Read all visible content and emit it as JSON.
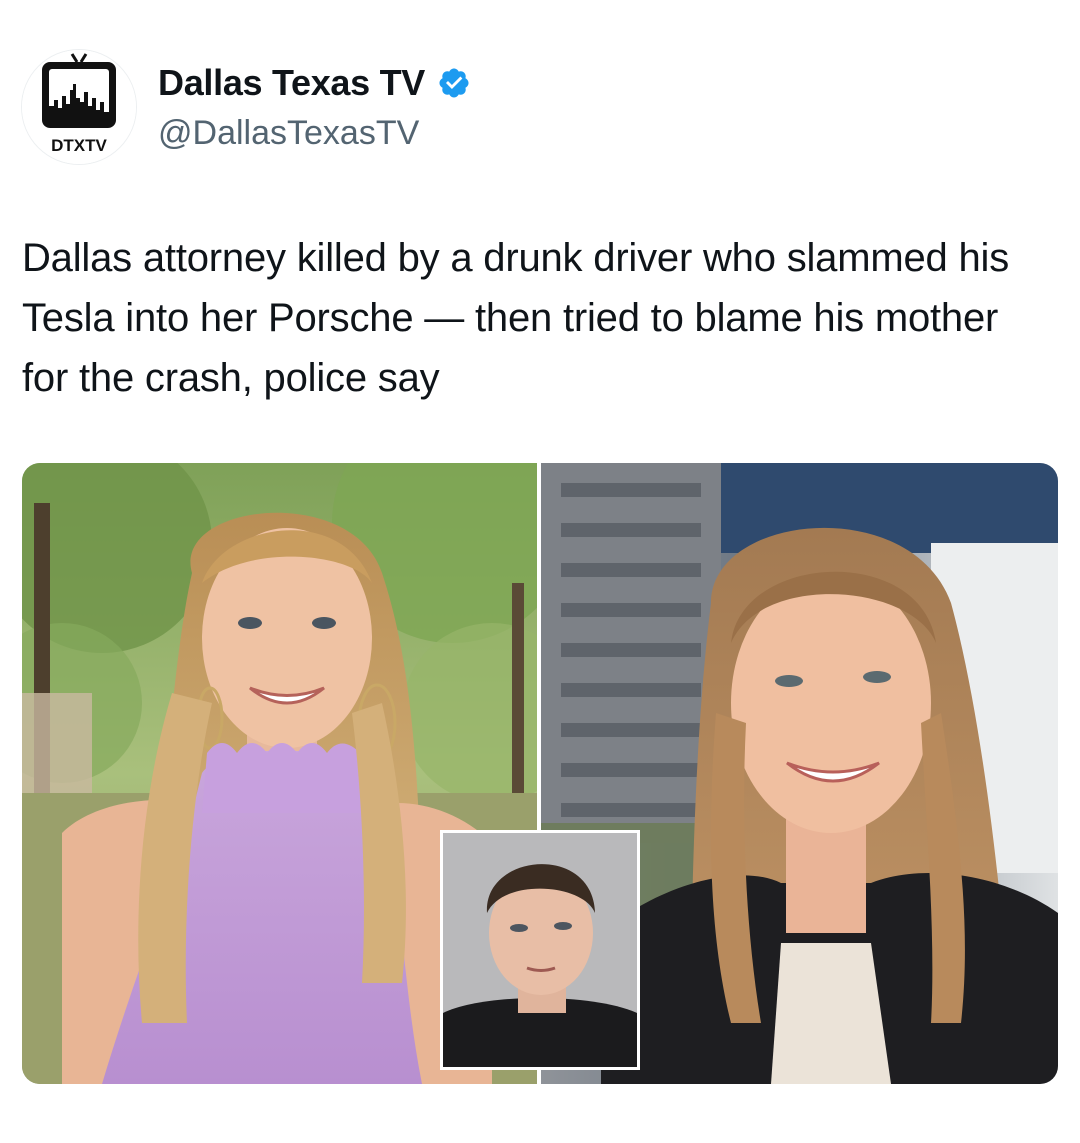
{
  "account": {
    "name": "Dallas Texas TV",
    "handle": "@DallasTexasTV",
    "avatar_label": "DTXTV",
    "verified_icon": "verified-badge-icon",
    "badge_color": "#1d9bf0"
  },
  "tweet": {
    "text": "Dallas attorney killed by a drunk driver who slammed his Tesla into her Porsche — then tried to blame his mother for the crash, police say"
  },
  "media": {
    "photos": [
      {
        "name": "photo-woman-outdoors",
        "description_icon": "photo"
      },
      {
        "name": "photo-woman-professional",
        "description_icon": "photo"
      },
      {
        "name": "photo-mugshot-inset",
        "description_icon": "photo"
      }
    ]
  },
  "colors": {
    "text_primary": "#0f1419",
    "text_secondary": "#536471",
    "accent": "#1d9bf0"
  }
}
